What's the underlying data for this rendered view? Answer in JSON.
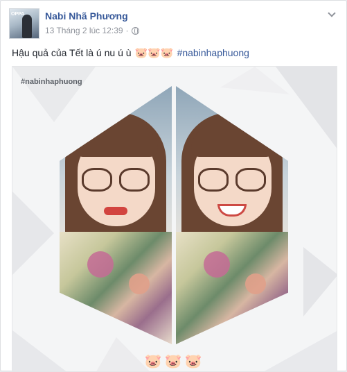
{
  "author": {
    "name": "Nabi Nhã Phương",
    "avatar_text": "OPPA"
  },
  "post": {
    "timestamp": "13 Tháng 2 lúc 12:39",
    "text": "Hậu quả của Tết là ú nu ú ù",
    "emojis": "🐷🐷🐷",
    "hashtag": "#nabinhaphuong"
  },
  "photo": {
    "watermark": "#nabinhaphuong",
    "bottom_emojis": "🐷🐷🐷"
  },
  "icons": {
    "privacy": "globe-icon",
    "menu": "chevron-down-icon"
  },
  "colors": {
    "link": "#365899",
    "meta": "#90949c",
    "text": "#1d2129"
  }
}
